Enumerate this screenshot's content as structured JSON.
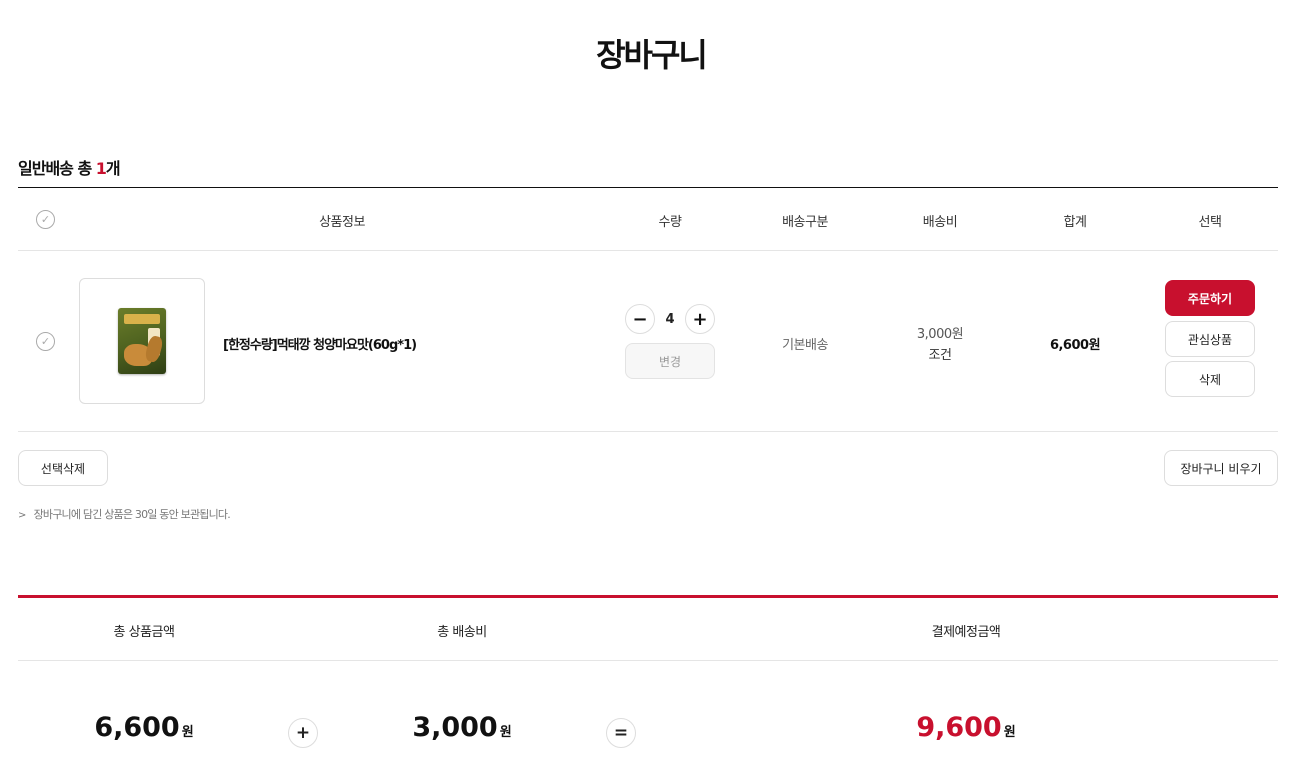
{
  "page": {
    "title": "장바구니"
  },
  "section": {
    "label": "일반배송 총 ",
    "count": "1",
    "count_suffix": "개"
  },
  "table": {
    "headers": {
      "product_info": "상품정보",
      "quantity": "수량",
      "shipping_type": "배송구분",
      "shipping_fee": "배송비",
      "total": "합계",
      "select": "선택"
    }
  },
  "item": {
    "name": "[한정수량]먹태깡 청양마요맛(60g*1)",
    "quantity": "4",
    "change_label": "변경",
    "shipping_type": "기본배송",
    "shipping_fee": "3,000원",
    "shipping_condition": "조건",
    "total": "6,600원",
    "order_label": "주문하기",
    "wishlist_label": "관심상품",
    "delete_label": "삭제"
  },
  "actions": {
    "delete_selected": "선택삭제",
    "empty_cart": "장바구니 비우기"
  },
  "notice": {
    "arrow": ">",
    "text": "장바구니에 담긴 상품은 30일 동안 보관됩니다."
  },
  "summary": {
    "headers": {
      "product_total": "총 상품금액",
      "shipping_total": "총 배송비",
      "payment_total": "결제예정금액"
    },
    "product_total": "6,600",
    "shipping_total": "3,000",
    "payment_total": "9,600",
    "unit": "원",
    "plus": "+",
    "equals": "="
  },
  "colors": {
    "accent": "#c8102e"
  },
  "icons": {
    "check": "check-circle-icon",
    "minus": "minus-icon",
    "plus": "plus-icon"
  }
}
